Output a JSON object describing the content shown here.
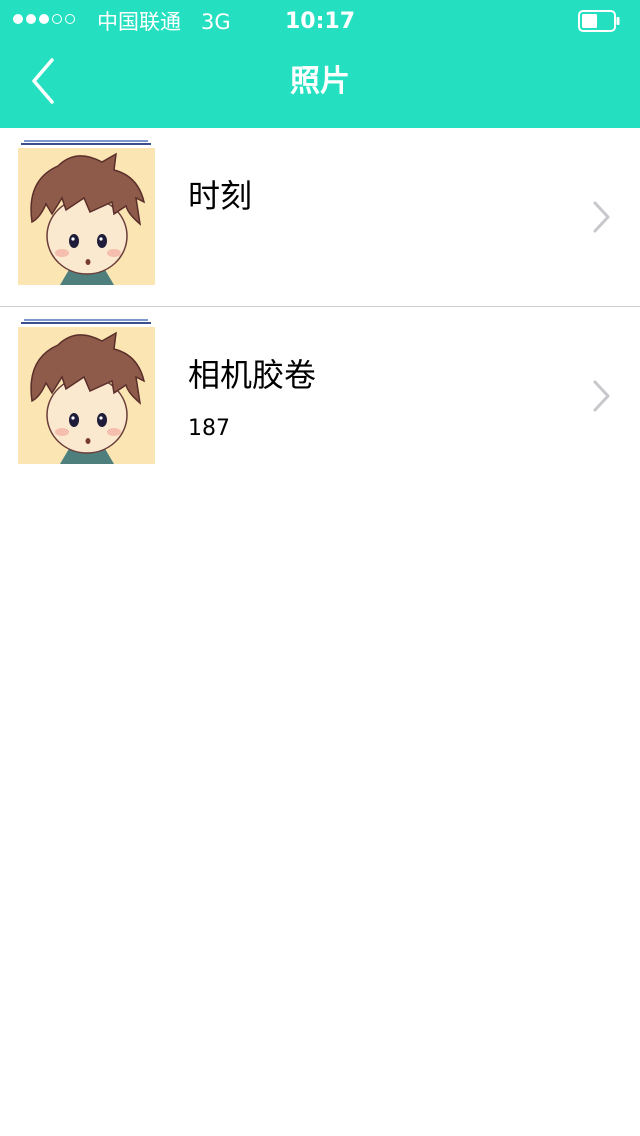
{
  "status_bar": {
    "carrier": "中国联通   3G",
    "time": "10:17",
    "signal_bars_filled": 3,
    "signal_bars_total": 5,
    "battery_level": 0.5
  },
  "nav": {
    "title": "照片",
    "back_icon": "chevron-left-icon"
  },
  "albums": [
    {
      "title": "时刻",
      "count": ""
    },
    {
      "title": "相机胶卷",
      "count": "187"
    }
  ],
  "colors": {
    "accent": "#24e0c1",
    "chevron": "#c7c7cc",
    "divider": "#cfcfcf"
  }
}
